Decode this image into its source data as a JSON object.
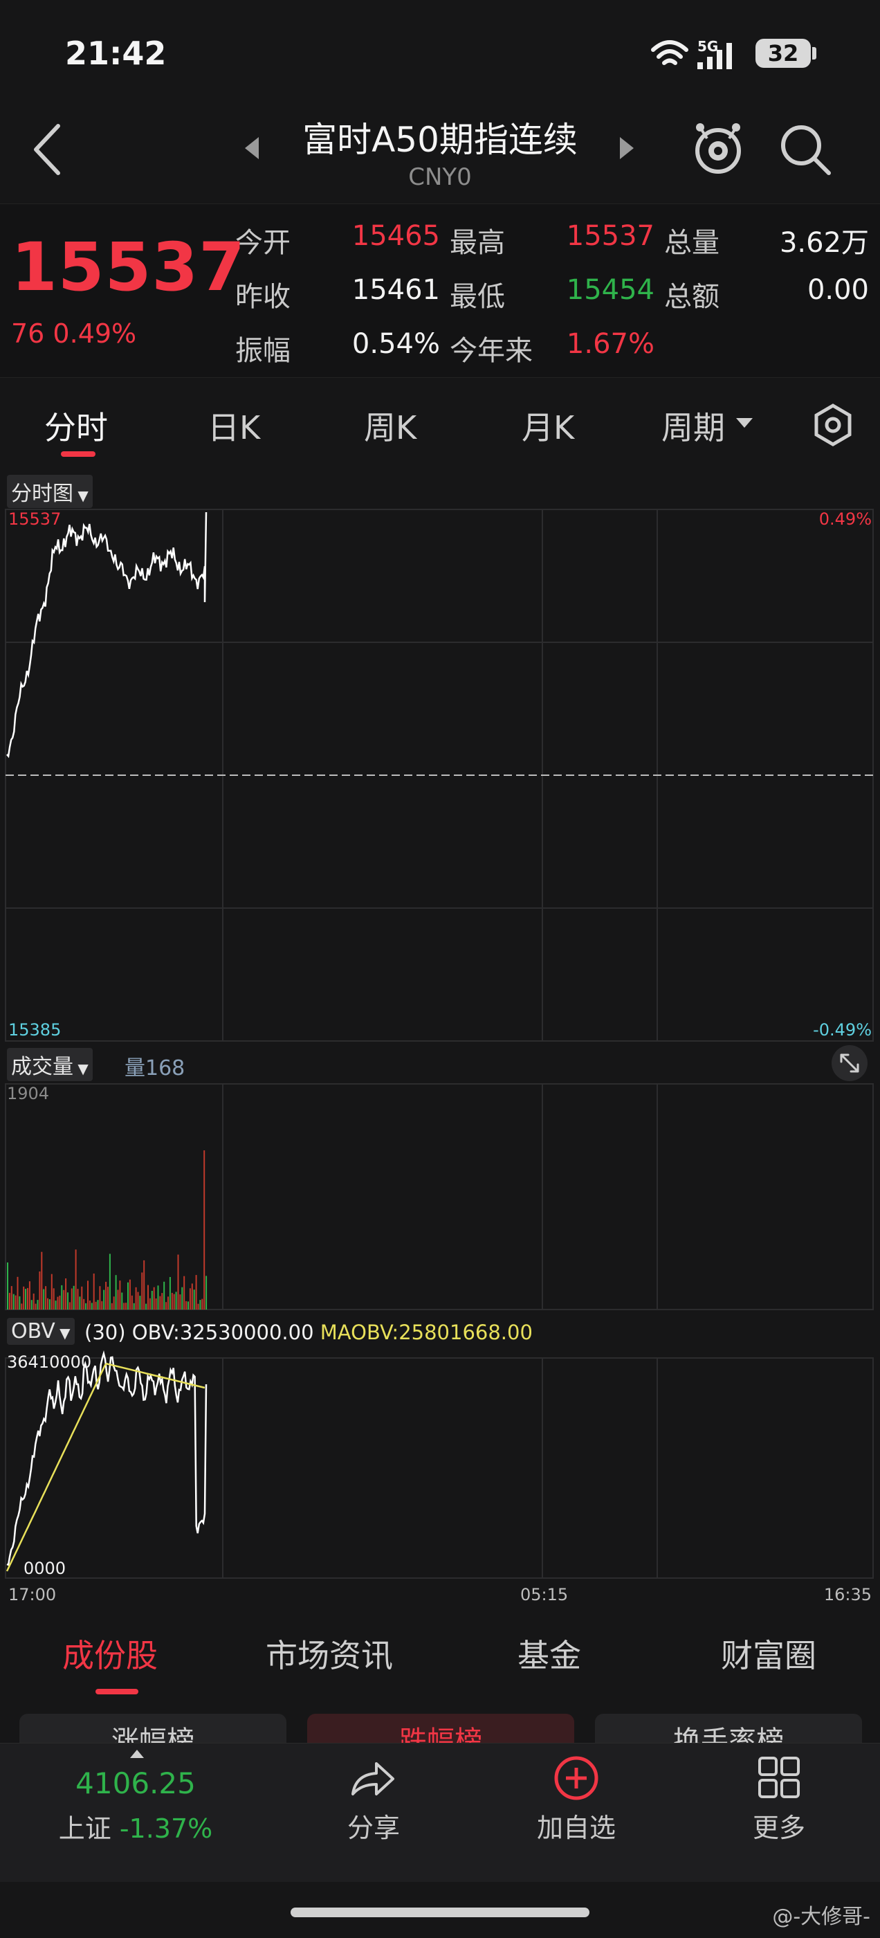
{
  "status_bar": {
    "time": "21:42",
    "network": "5G",
    "battery": "32"
  },
  "nav": {
    "title": "富时A50期指连续",
    "code": "CNY0"
  },
  "quote": {
    "price": "15537",
    "change": "76  0.49%",
    "fields": [
      {
        "label": "今开",
        "value": "15465",
        "color": "#f23645"
      },
      {
        "label": "最高",
        "value": "15537",
        "color": "#f23645"
      },
      {
        "label": "总量",
        "value": "3.62万",
        "color": "#f2f2f2"
      },
      {
        "label": "昨收",
        "value": "15461",
        "color": "#f2f2f2"
      },
      {
        "label": "最低",
        "value": "15454",
        "color": "#2fb34b"
      },
      {
        "label": "总额",
        "value": "0.00",
        "color": "#f2f2f2"
      },
      {
        "label": "振幅",
        "value": "0.54%",
        "color": "#f2f2f2"
      },
      {
        "label": "今年来",
        "value": "1.67%",
        "color": "#f23645"
      }
    ]
  },
  "tabs": [
    "分时",
    "日K",
    "周K",
    "月K",
    "周期"
  ],
  "price_chart": {
    "selector": "分时图",
    "top_label": "15537",
    "bottom_label": "15385",
    "top_pct": "0.49%",
    "bottom_pct": "-0.49%"
  },
  "volume_chart": {
    "selector": "成交量",
    "readout": "量168",
    "top_label": "1904"
  },
  "obv_chart": {
    "selector": "OBV",
    "param": "(30)",
    "obv_label": "OBV:32530000.00",
    "maobv_label": "MAOBV:25801668.00",
    "top_label": "36410000",
    "bottom_label": "0000"
  },
  "time_axis": [
    "17:00",
    "05:15",
    "16:35"
  ],
  "bottom_tabs": [
    "成份股",
    "市场资讯",
    "基金",
    "财富圈"
  ],
  "sub_buttons": [
    "涨幅榜",
    "跌幅榜",
    "换手率榜"
  ],
  "toolbar": {
    "index_value": "4106.25",
    "index_name": "上证",
    "index_change": "-1.37%",
    "share": "分享",
    "add": "加自选",
    "more": "更多"
  },
  "watermark": "@-大修哥-",
  "colors": {
    "up": "#f23645",
    "down": "#2fb34b",
    "line": "#ffffff",
    "ma_line": "#e8e05a",
    "cyan": "#5fd0e0"
  }
}
